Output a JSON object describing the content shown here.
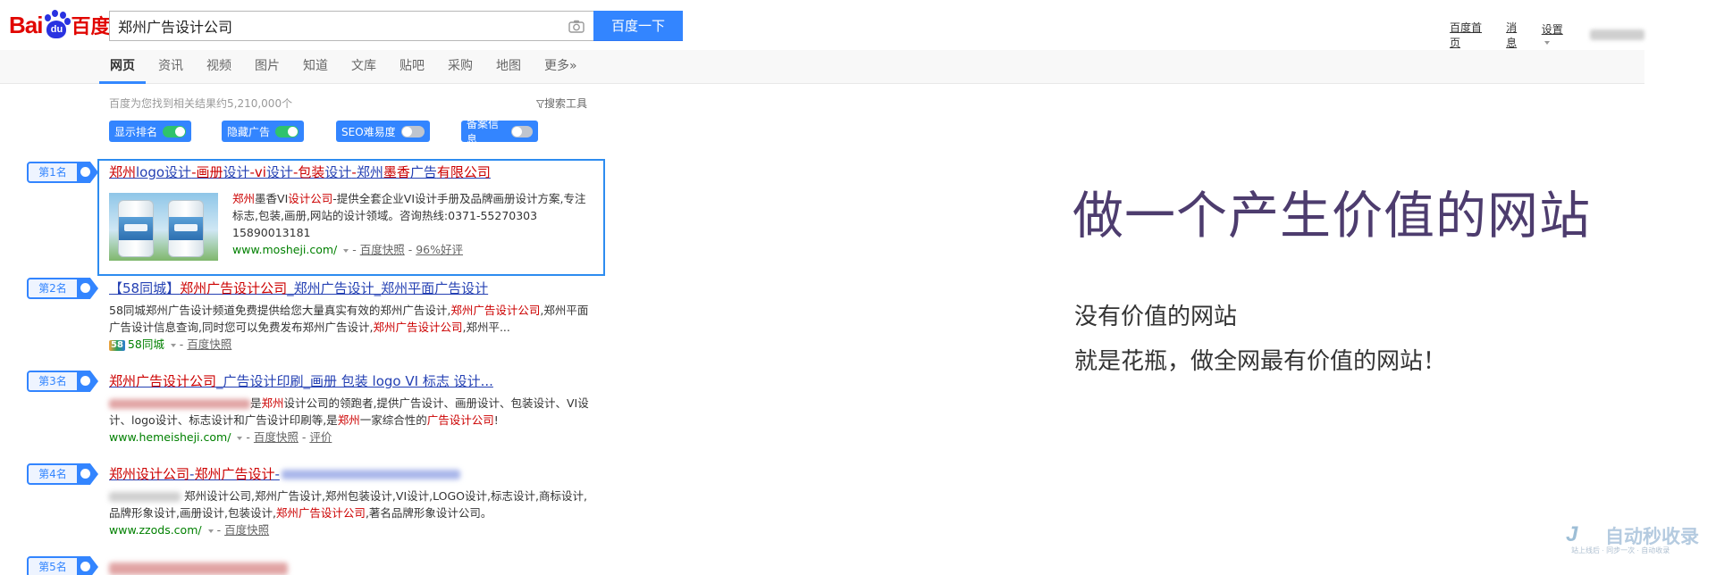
{
  "logo": {
    "latin": "Bai",
    "paw_text": "du",
    "chinese": "百度"
  },
  "search": {
    "query": "郑州广告设计公司",
    "button_label": "百度一下"
  },
  "top_links": {
    "home": "百度首页",
    "messages": "消息",
    "settings": "设置"
  },
  "tabs": [
    "网页",
    "资讯",
    "视频",
    "图片",
    "知道",
    "文库",
    "贴吧",
    "采购",
    "地图",
    "更多»"
  ],
  "results_meta": {
    "count_text": "百度为您找到相关结果约5,210,000个",
    "search_tools": "搜索工具"
  },
  "toggles": [
    {
      "label": "显示排名",
      "state": "on"
    },
    {
      "label": "隐藏广告",
      "state": "on"
    },
    {
      "label": "SEO难易度",
      "state": "off"
    },
    {
      "label": "备案信息",
      "state": "off"
    }
  ],
  "ranks": [
    "第1名",
    "第2名",
    "第3名",
    "第4名",
    "第5名"
  ],
  "results": [
    {
      "title_parts": [
        "郑州",
        "logo设计",
        "-画册",
        "设计",
        "-vi",
        "设计",
        "-包装",
        "设计",
        "-",
        "郑州",
        "墨香",
        "广告",
        "有限公司"
      ],
      "abstract": {
        "p1": "郑州",
        "p2": "墨香VI",
        "p3": "设计公司",
        "p4": "-提供全套企业VI设计手册及品牌画册设计方案,专注标志,包装,画册,网站的设计领域。咨询热线:0371-55270303 15890013181"
      },
      "url": "www.mosheji.com/",
      "snapshot": "百度快照",
      "rating": "96%好评"
    },
    {
      "title_pre": "【58同城】",
      "title_hl1": "郑州广告设计公司",
      "title_mid": "_郑州广告设计_",
      "title_end": "郑州平面广告设计",
      "abstract": {
        "p1": "58同城郑州广告设计频道免费提供给您大量真实有效的郑州广告设计,",
        "p2": "郑州广告设计公司",
        "p3": ",郑州平面广告设计信息查询,同时您可以免费发布郑州广告设计,",
        "p4": "郑州广告设计公司",
        "p5": ",郑州平..."
      },
      "source_icon": "58",
      "source": "58同城",
      "snapshot": "百度快照"
    },
    {
      "title_a": "郑州广告设计公司",
      "title_b": "_广告设计印刷_画册 包装 logo VI 标志 设计...",
      "abstract": {
        "p1": "是",
        "p2": "郑州",
        "p3": "设计公司的领跑者,提供广告设计、画册设计、包装设计、VI设计、logo设计、标志设计和广告设计印刷等,是",
        "p4": "郑州",
        "p5": "一家综合性的",
        "p6": "广告设计公司",
        "p7": "!"
      },
      "url": "www.hemeisheji.com/",
      "snapshot": "百度快照",
      "extra": "评价"
    },
    {
      "title_a": "郑州设计公司",
      "title_b": "-",
      "title_c": "郑州广告设计",
      "title_d": "-",
      "abstract": {
        "p1": "郑州设计公司,郑州广告设计,郑州包装设计,VI设计,LOGO设计,标志设计,商标设计,品牌形象设计,画册设计,包装设计,",
        "p2": "郑州广告设计公司",
        "p3": ",著名品牌形象设计公司。"
      },
      "url": "www.zzods.com/",
      "snapshot": "百度快照"
    }
  ],
  "right_panel": {
    "slogan": "做一个产生价值的网站",
    "line1": "没有价值的网站",
    "line2": "就是花瓶，做全网最有价值的网站！"
  },
  "watermark": {
    "mark": "J",
    "name": "自动秒收录",
    "sub": "站上线后 · 同步一次 · 自动收录"
  },
  "colors": {
    "accent_blue": "#3385ff",
    "result_link": "#2440b3",
    "highlight_red": "#c00",
    "url_green": "#008000",
    "slogan_purple": "#4d3c6e"
  }
}
